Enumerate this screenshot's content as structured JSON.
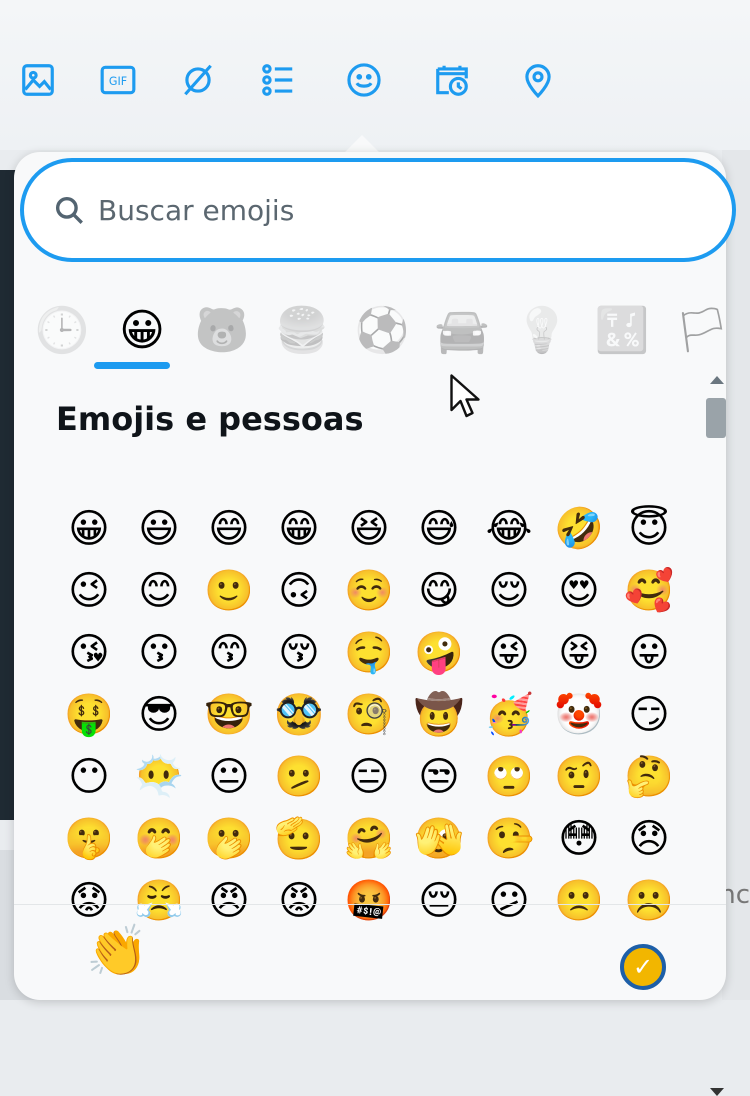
{
  "toolbar": {
    "icons": [
      "image-icon",
      "gif-icon",
      "grok-icon",
      "poll-icon",
      "emoji-icon",
      "schedule-icon",
      "location-icon"
    ],
    "accent_color": "#1d9bf0",
    "gif_label": "GIF"
  },
  "picker": {
    "search": {
      "placeholder": "Buscar emojis"
    },
    "tabs": [
      {
        "name": "recent",
        "glyph": "🕒",
        "active": false
      },
      {
        "name": "smileys",
        "glyph": "😀",
        "active": true
      },
      {
        "name": "animals",
        "glyph": "🐻",
        "active": false
      },
      {
        "name": "food",
        "glyph": "🍔",
        "active": false
      },
      {
        "name": "activities",
        "glyph": "⚽",
        "active": false
      },
      {
        "name": "travel",
        "glyph": "🚘",
        "active": false
      },
      {
        "name": "objects",
        "glyph": "💡",
        "active": false
      },
      {
        "name": "symbols",
        "glyph": "🔣",
        "active": false
      },
      {
        "name": "flags",
        "glyph": "🏳",
        "active": false
      }
    ],
    "section_title": "Emojis e pessoas",
    "emojis": [
      "😀",
      "😃",
      "😄",
      "😁",
      "😆",
      "😅",
      "😂",
      "🤣",
      "😇",
      "😉",
      "😊",
      "🙂",
      "🙃",
      "☺️",
      "😋",
      "😌",
      "😍",
      "🥰",
      "😘",
      "😗",
      "😙",
      "😚",
      "🤤",
      "🤪",
      "😜",
      "😝",
      "😛",
      "🤑",
      "😎",
      "🤓",
      "🥸",
      "🧐",
      "🤠",
      "🥳",
      "🤡",
      "😏",
      "😶",
      "😶‍🌫️",
      "😐",
      "🫤",
      "😑",
      "😒",
      "🙄",
      "🤨",
      "🤔",
      "🤫",
      "🤭",
      "🫢",
      "🫡",
      "🤗",
      "🫣",
      "🤥",
      "😳",
      "😞",
      "😟",
      "😤",
      "😠",
      "😡",
      "🤬",
      "😔",
      "😕",
      "🙁",
      "☹️"
    ],
    "skin_tone": "👏",
    "confirm_color": "#f2b600"
  },
  "background": {
    "right_text": "nc"
  }
}
